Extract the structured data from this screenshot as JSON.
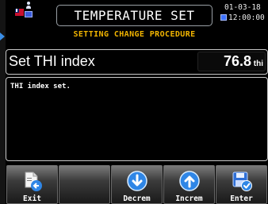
{
  "header": {
    "title": "TEMPERATURE SET",
    "subtitle": "SETTING CHANGE PROCEDURE",
    "date": "01-03-18",
    "time": "12:00:00",
    "language_icon": "uk-flag-icon",
    "user_icon": "operator-badge-icon",
    "clock_icon": "clock-icon"
  },
  "param": {
    "name": "Set THI index",
    "value": "76.8",
    "unit": "thi"
  },
  "message": {
    "text": "THI index set."
  },
  "toolbar": {
    "buttons": [
      {
        "label": "Exit",
        "icon": "exit-document-icon"
      },
      {
        "label": "",
        "icon": ""
      },
      {
        "label": "Decrem",
        "icon": "arrow-down-circle-icon"
      },
      {
        "label": "Increm",
        "icon": "arrow-up-circle-icon"
      },
      {
        "label": "Enter",
        "icon": "save-check-icon"
      }
    ]
  },
  "colors": {
    "subtitle": "#f1b400",
    "accent_blue": "#2f86e6",
    "panel_border": "#c8c8c8"
  }
}
